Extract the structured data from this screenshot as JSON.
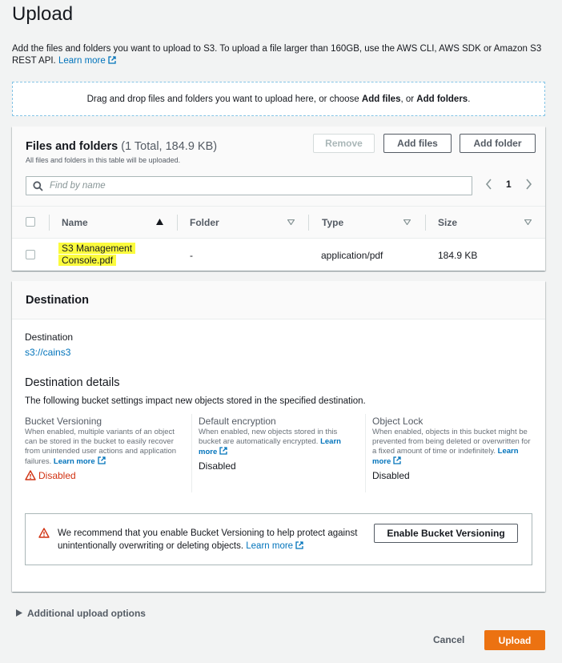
{
  "page": {
    "title": "Upload",
    "intro_text": "Add the files and folders you want to upload to S3. To upload a file larger than 160GB, use the AWS CLI, AWS SDK or Amazon S3 REST API.",
    "learn_more": "Learn more"
  },
  "dropzone": {
    "text_before": "Drag and drop files and folders you want to upload here, or choose ",
    "add_files": "Add files",
    "or": ", or ",
    "add_folders": "Add folders",
    "period": "."
  },
  "files": {
    "title": "Files and folders",
    "count": "(1 Total, 184.9 KB)",
    "description": "All files and folders in this table will be uploaded.",
    "remove_label": "Remove",
    "add_files_label": "Add files",
    "add_folder_label": "Add folder",
    "search_placeholder": "Find by name",
    "page_number": "1",
    "columns": [
      "Name",
      "Folder",
      "Type",
      "Size"
    ],
    "rows": [
      {
        "name_line1": "S3 Management",
        "name_line2": "Console.pdf",
        "folder": "-",
        "type": "application/pdf",
        "size": "184.9 KB"
      }
    ]
  },
  "destination": {
    "section_title": "Destination",
    "label": "Destination",
    "value": "s3://cains3",
    "details_title": "Destination details",
    "details_desc": "The following bucket settings impact new objects stored in the specified destination.",
    "versioning": {
      "title": "Bucket Versioning",
      "desc": "When enabled, multiple variants of an object can be stored in the bucket to easily recover from unintended user actions and application failures.",
      "learn_more": "Learn more",
      "status": "Disabled"
    },
    "encryption": {
      "title": "Default encryption",
      "desc": "When enabled, new objects stored in this bucket are automatically encrypted.",
      "learn_more": "Learn more",
      "status": "Disabled"
    },
    "object_lock": {
      "title": "Object Lock",
      "desc": "When enabled, objects in this bucket might be prevented from being deleted or overwritten for a fixed amount of time or indefinitely.",
      "learn_more": "Learn more",
      "status": "Disabled"
    },
    "alert": {
      "message": "We recommend that you enable Bucket Versioning to help protect against unintentionally overwriting or deleting objects.",
      "learn_more": "Learn more",
      "button_label": "Enable Bucket Versioning"
    }
  },
  "footer": {
    "additional_options": "Additional upload options",
    "cancel_label": "Cancel",
    "upload_label": "Upload"
  },
  "colors": {
    "link": "#0073bb",
    "primary_button": "#ec7211",
    "warning_red": "#d13212",
    "highlight": "#fbfb3d"
  }
}
